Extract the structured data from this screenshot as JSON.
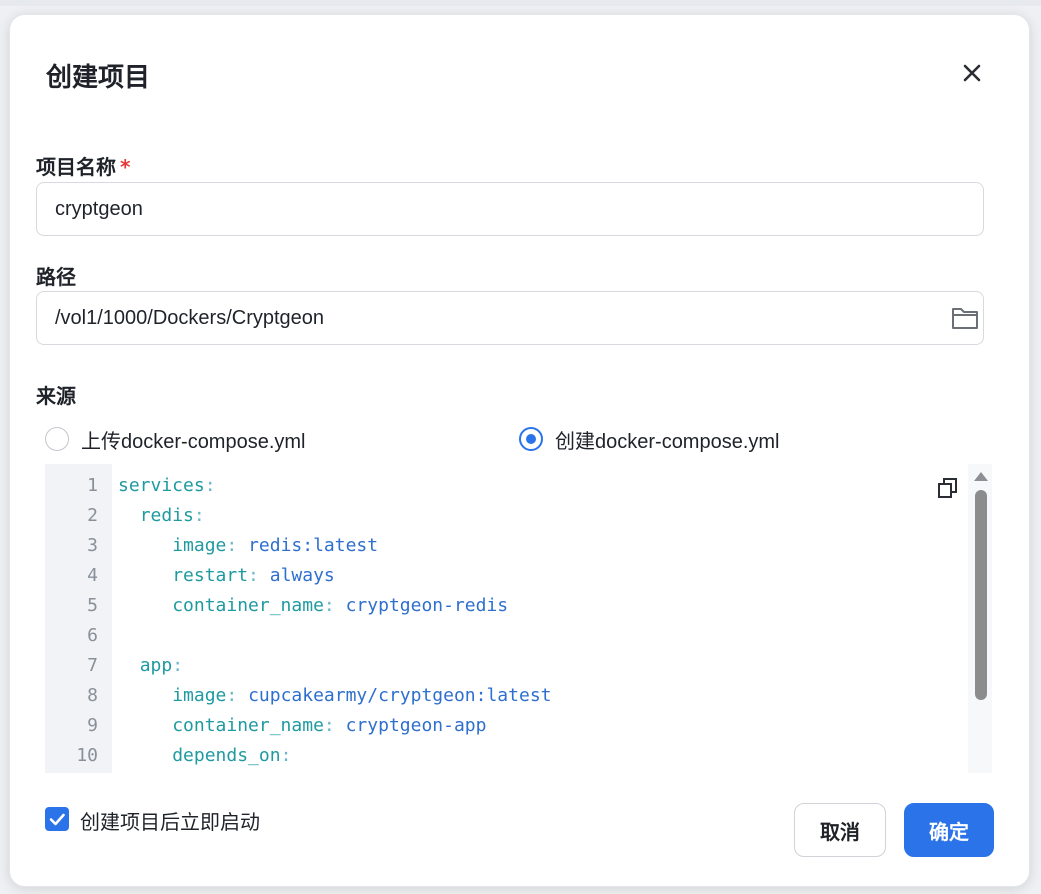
{
  "dialog": {
    "title": "创建项目",
    "close_icon": "close-icon"
  },
  "form": {
    "name": {
      "label": "项目名称",
      "required_mark": "*",
      "value": "cryptgeon"
    },
    "path": {
      "label": "路径",
      "value": "/vol1/1000/Dockers/Cryptgeon",
      "icon": "folder-icon"
    },
    "source": {
      "label": "来源",
      "options": [
        {
          "label": "上传docker-compose.yml",
          "selected": false
        },
        {
          "label": "创建docker-compose.yml",
          "selected": true
        }
      ]
    }
  },
  "editor": {
    "copy_icon": "copy-icon",
    "lines": [
      {
        "n": "1",
        "indent": "",
        "key": "services",
        "sep": ":",
        "value": ""
      },
      {
        "n": "2",
        "indent": "  ",
        "key": "redis",
        "sep": ":",
        "value": ""
      },
      {
        "n": "3",
        "indent": "     ",
        "key": "image",
        "sep": ": ",
        "value": "redis:latest"
      },
      {
        "n": "4",
        "indent": "     ",
        "key": "restart",
        "sep": ": ",
        "value": "always"
      },
      {
        "n": "5",
        "indent": "     ",
        "key": "container_name",
        "sep": ": ",
        "value": "cryptgeon-redis"
      },
      {
        "n": "6",
        "indent": "",
        "key": "",
        "sep": "",
        "value": ""
      },
      {
        "n": "7",
        "indent": "  ",
        "key": "app",
        "sep": ":",
        "value": ""
      },
      {
        "n": "8",
        "indent": "     ",
        "key": "image",
        "sep": ": ",
        "value": "cupcakearmy/cryptgeon:latest"
      },
      {
        "n": "9",
        "indent": "     ",
        "key": "container_name",
        "sep": ": ",
        "value": "cryptgeon-app"
      },
      {
        "n": "10",
        "indent": "     ",
        "key": "depends_on",
        "sep": ":",
        "value": ""
      }
    ]
  },
  "footer": {
    "autostart_label": "创建项目后立即启动",
    "autostart_checked": true,
    "cancel_label": "取消",
    "ok_label": "确定"
  },
  "colors": {
    "accent": "#2b73e8",
    "required": "#e5393c",
    "yaml_key": "#1f9aa0",
    "yaml_value": "#2e6fcf"
  }
}
